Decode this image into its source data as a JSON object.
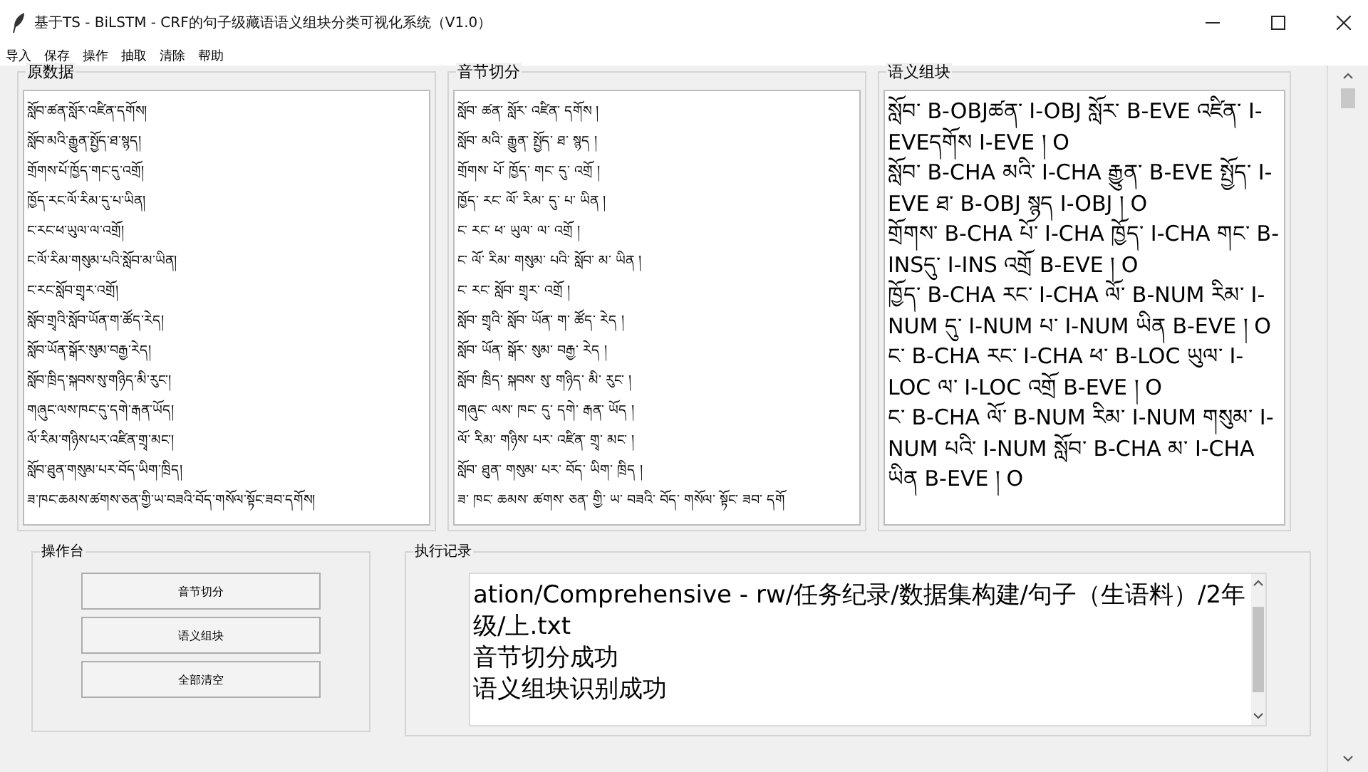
{
  "window": {
    "title": "基于TS - BiLSTM - CRF的句子级藏语语义组块分类可视化系统（V1.0）"
  },
  "menu": [
    "导入",
    "保存",
    "操作",
    "抽取",
    "清除",
    "帮助"
  ],
  "panels": [
    {
      "title": "原数据",
      "kind": "plain",
      "lines": [
        "སློབ་ཚན་སློར་འཛིན་དགོས།",
        "སློབ་མའི་རྒྱུན་སྤྱོད་ཐ་སྙད།",
        "གྲོགས་པོ་ཁྱོད་གང་དུ་འགྲོ།",
        "ཁྱོད་རང་ལོ་རིམ་དུ་པ་ཡིན།",
        "ང་རང་ཕ་ཡུལ་ལ་འགྲོ།",
        "ང་ལོ་རིམ་གསུམ་པའི་སློབ་མ་ཡིན།",
        "ང་རང་སློབ་གྲྭར་འགྲོ།",
        "སློབ་གྲྭའི་སློབ་ཡོན་ག་ཚོད་རེད།",
        "སློབ་ཡོན་སྒོར་སུམ་བརྒྱ་རེད།",
        "སློབ་ཁྲིད་སྐབས་སུ་གཉིད་མི་རུང་།",
        "གཞུང་ལས་ཁང་དུ་དགེ་རྒན་ཡོད།",
        "ལོ་རིམ་གཉིས་པར་འཛིན་གྲྭ་མང་།",
        "སློབ་ཐུན་གསུམ་པར་བོད་ཡིག་ཁྲིད།",
        "ཟ་ཁང་ཆམས་ཚགས་ཅན་གྱི་ཡ་བཟའི་བོད་གསོལ་སྟོང་ཟབ་དགོས།"
      ]
    },
    {
      "title": "音节切分",
      "kind": "plain",
      "lines": [
        "སློབ་ ཚན་ སློར་ འཛིན་ དགོས །",
        "སློབ་ མའི་ རྒྱུན་ སྤྱོད་ ཐ་ སྙད །",
        "གྲོགས་ པོ་ ཁྱོད་ གང་ དུ་ འགྲོ །",
        "ཁྱོད་ རང་ ལོ་ རིམ་ དུ་ པ་ ཡིན །",
        "ང་ རང་ ཕ་ ཡུལ་ ལ་ འགྲོ །",
        "ང་ ལོ་ རིམ་ གསུམ་ པའི་ སློབ་ མ་ ཡིན །",
        "ང་ རང་ སློབ་ གྲྭར་ འགྲོ །",
        "སློབ་ གྲྭའི་ སློབ་ ཡོན་ ག་ ཚོད་ རེད །",
        "སློབ་ ཡོན་ སྒོར་ སུམ་ བརྒྱ་ རེད །",
        "སློབ་ ཁྲིད་ སྐབས་ སུ་ གཉིད་ མི་ རུང་ །",
        "གཞུང་ ལས་ ཁང་ དུ་ དགེ་ རྒན་ ཡོད །",
        "ལོ་ རིམ་ གཉིས་ པར་ འཛིན་ གྲྭ་ མང་ །",
        "སློབ་ ཐུན་ གསུམ་ པར་ བོད་ ཡིག་ ཁྲིད །",
        "ཟ་ ཁང་ ཆམས་ ཚགས་ ཅན་ གྱི་ ཡ་ བཟའི་ བོད་ གསོལ་ སྟོང་ ཟབ་ དགོ"
      ]
    },
    {
      "title": "语义组块",
      "kind": "tagged",
      "lines": [
        "སློབ་ B-OBJཚན་ I-OBJ སློར་ B-EVE འཛིན་ I-EVEདགོས I-EVE ། O",
        "སློབ་ B-CHA མའི་ I-CHA རྒྱུན་ B-EVE སྤྱོད་ I-EVE ཐ་ B-OBJ སྙད I-OBJ ། O",
        "གྲོགས་ B-CHA པོ་ I-CHA ཁྱོད་ I-CHA གང་ B-INSདུ་ I-INS འགྲོ B-EVE ། O",
        "ཁྱོད་ B-CHA རང་ I-CHA ལོ་ B-NUM རིམ་ I-NUM དུ་ I-NUM པ་ I-NUM ཡིན B-EVE ། O",
        "ང་ B-CHA རང་ I-CHA ཕ་ B-LOC ཡུལ་ I-LOC ལ་ I-LOC འགྲོ B-EVE ། O",
        "ང་ B-CHA ལོ་ B-NUM རིམ་ I-NUM གསུམ་ I-NUM པའི་ I-NUM སློབ་ B-CHA མ་ I-CHA ཡིན B-EVE ། O"
      ]
    }
  ],
  "console": {
    "title": "操作台",
    "buttons": [
      "音节切分",
      "语义组块",
      "全部清空"
    ]
  },
  "log": {
    "title": "执行记录",
    "lines": [
      "ation/Comprehensive - rw/任务纪录/数据集构建/句子（生语料）/2年级/上.txt",
      "音节切分成功",
      "语义组块识别成功"
    ]
  }
}
